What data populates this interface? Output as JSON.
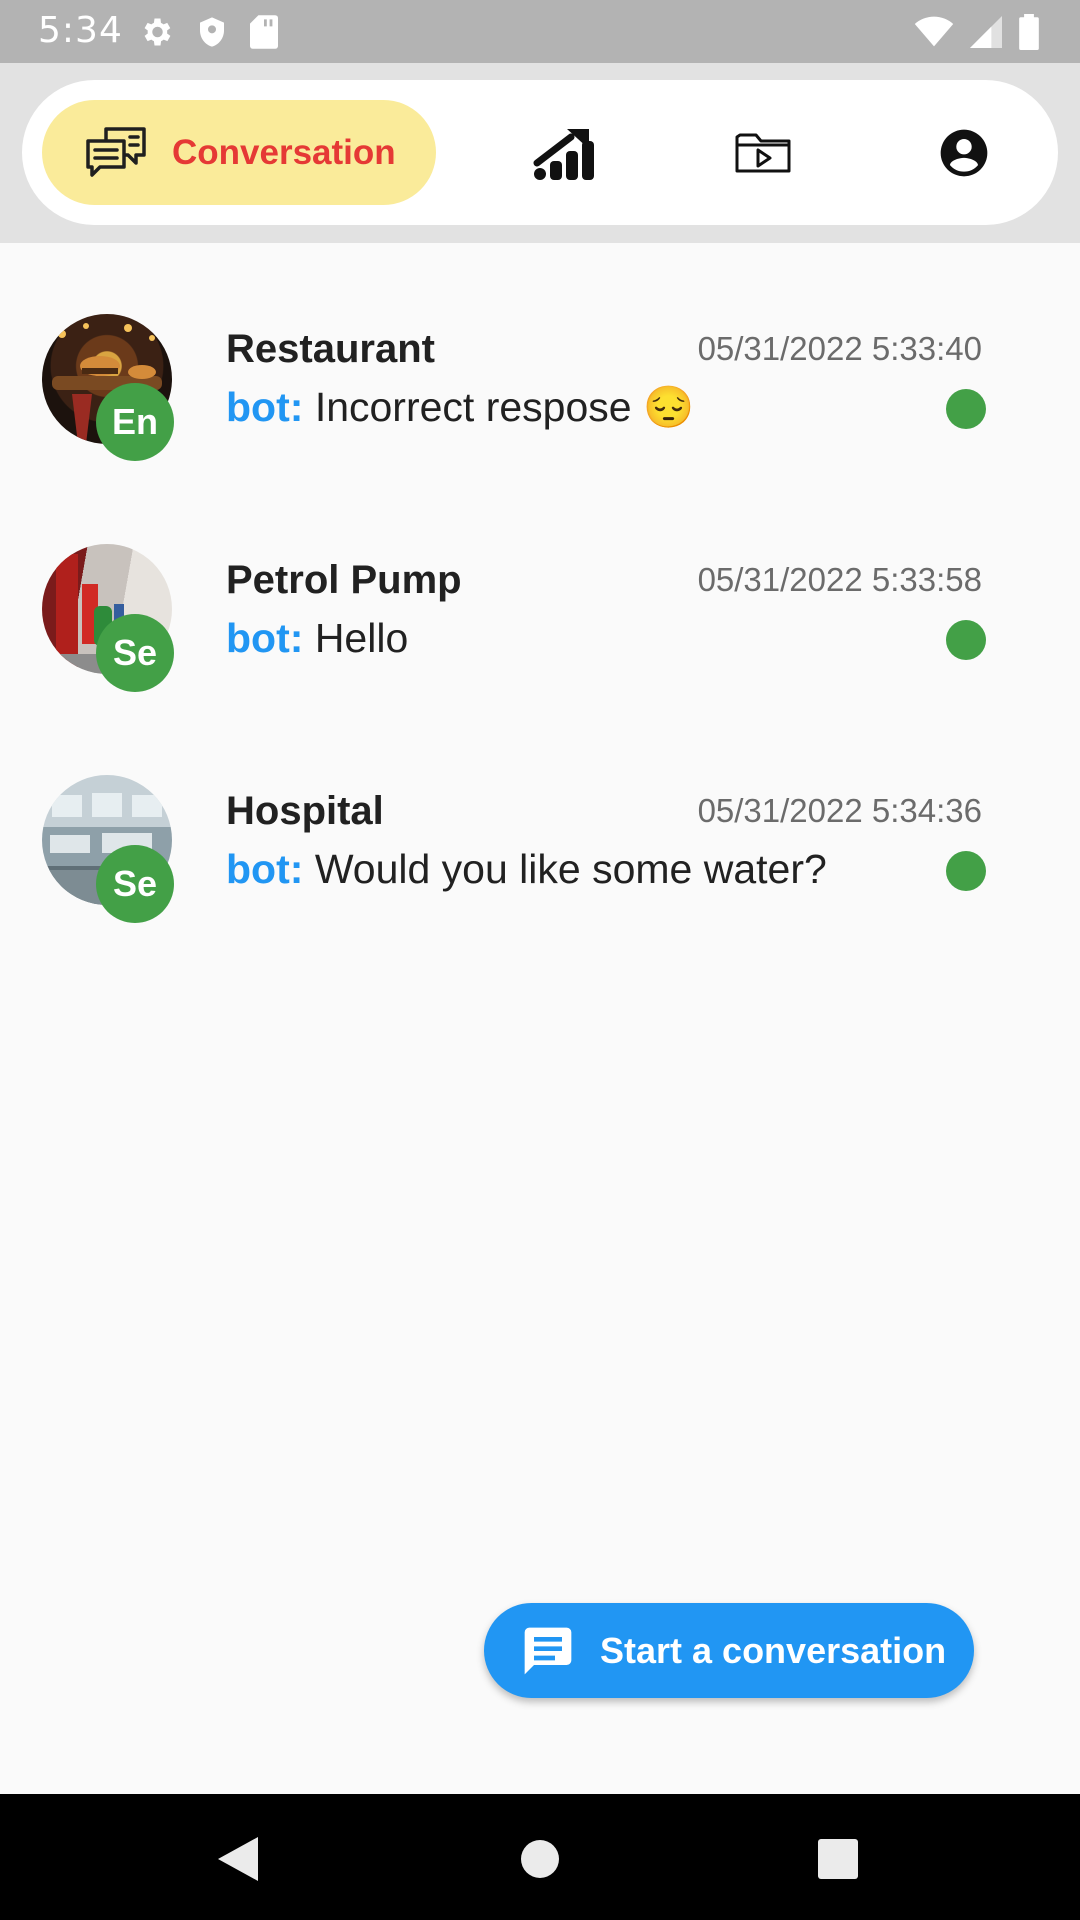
{
  "status_bar": {
    "time": "5:34",
    "icons_left": [
      "gear-icon",
      "shield-icon",
      "sd-card-icon"
    ],
    "icons_right": [
      "wifi-icon",
      "signal-icon",
      "battery-icon"
    ]
  },
  "nav": {
    "active_tab": {
      "label": "Conversation",
      "icon": "chat-bubbles-icon",
      "bg_color": "#faeb9a",
      "text_color": "#e53935"
    },
    "tabs": [
      {
        "icon": "analytics-icon"
      },
      {
        "icon": "video-folder-icon"
      },
      {
        "icon": "account-icon"
      }
    ]
  },
  "conversations": [
    {
      "title": "Restaurant",
      "timestamp": "05/31/2022 5:33:40",
      "sender": "bot:",
      "message": "Incorrect respose 😔",
      "language": "En",
      "online": true
    },
    {
      "title": "Petrol Pump",
      "timestamp": "05/31/2022 5:33:58",
      "sender": "bot:",
      "message": "Hello",
      "language": "Se",
      "online": true
    },
    {
      "title": "Hospital",
      "timestamp": "05/31/2022 5:34:36",
      "sender": "bot:",
      "message": "Would you like some water?",
      "language": "Se",
      "online": true
    }
  ],
  "fab": {
    "label": "Start a conversation",
    "icon": "message-icon",
    "color": "#2196f3"
  },
  "colors": {
    "accent": "#2196f3",
    "online": "#43a047",
    "badge": "#43a047"
  }
}
